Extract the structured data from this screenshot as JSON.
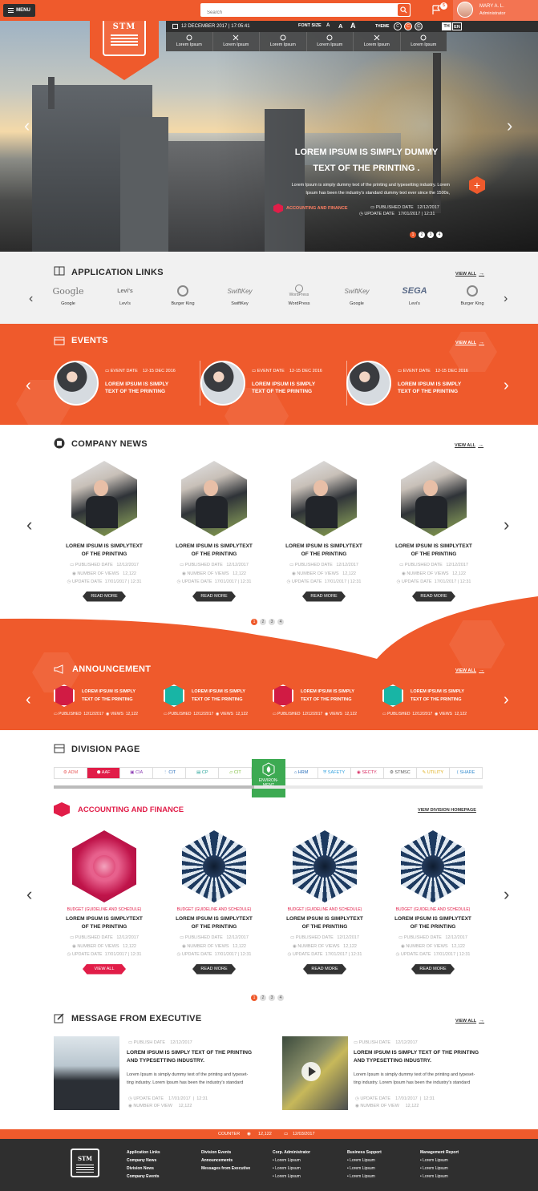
{
  "topbar": {
    "menu_label": "MENU",
    "search_placeholder": "Search",
    "notif_count": "5",
    "user_name": "MARY A. L.",
    "user_role": "Administrator"
  },
  "subbar": {
    "date": "12 DECEMBER 2017 | 17:05:41",
    "font_size_label": "FONT SIZE",
    "font_a": [
      "A",
      "A",
      "A"
    ],
    "theme_label": "THEME",
    "theme_options": [
      "C",
      "C",
      "C"
    ],
    "lang": [
      "TH",
      "EN"
    ]
  },
  "logo": "STM",
  "quicklinks": [
    "Lorem Ipsum",
    "Lorem Ipsum",
    "Lorem Ipsum",
    "Lorem Ipsum",
    "Lorem Ipsum",
    "Lorem Ipsum"
  ],
  "hero": {
    "title1": "LOREM IPSUM IS SIMPLY DUMMY",
    "title2": "TEXT OF THE PRINTING .",
    "desc1": "Lorem Ipsum is simply dummy text of the printing and typesetting industry. Lorem",
    "desc2": "Ipsum has been the industry's standard dummy text ever since the 1500s,",
    "tag": "ACCOUNTING AND FINANCE",
    "pub_label": "PUBLISHED DATE",
    "pub_date": "12/12/2017",
    "upd_label": "UPDATE DATE",
    "upd_date": "17/01/2017",
    "upd_time": "12:31",
    "dots": [
      "1",
      "2",
      "3",
      "4"
    ],
    "active_dot": 1
  },
  "app_links": {
    "title": "APPLICATION LINKS",
    "view_all": "VIEW ALL",
    "items": [
      {
        "logo": "Google",
        "name": "Google"
      },
      {
        "logo": "Levi's",
        "name": "Levi's"
      },
      {
        "logo": "",
        "name": "Burger King"
      },
      {
        "logo": "SwiftKey",
        "name": "SwiftKey"
      },
      {
        "logo": "WordPress",
        "name": "WordPress"
      },
      {
        "logo": "SwiftKey",
        "name": "Google"
      },
      {
        "logo": "SEGA",
        "name": "Levi's"
      },
      {
        "logo": "",
        "name": "Burger King"
      }
    ]
  },
  "events": {
    "title": "EVENTS",
    "view_all": "VIEW ALL",
    "items": [
      {
        "date_label": "EVENT DATE",
        "date": "12-15 DEC 2016",
        "title1": "LOREM IPSUM IS SIMPLY",
        "title2": "TEXT OF THE PRINTING"
      },
      {
        "date_label": "EVENT DATE",
        "date": "12-15 DEC 2016",
        "title1": "LOREM IPSUM IS SIMPLY",
        "title2": "TEXT OF THE PRINTING"
      },
      {
        "date_label": "EVENT DATE",
        "date": "12-15 DEC 2016",
        "title1": "LOREM IPSUM IS SIMPLY",
        "title2": "TEXT OF THE PRINTING"
      }
    ]
  },
  "news": {
    "title": "COMPANY NEWS",
    "view_all": "VIEW ALL",
    "items": [
      {
        "title1": "LOREM IPSUM IS SIMPLYTEXT",
        "title2": "OF THE PRINTING",
        "pub": "PUBLISHED DATE",
        "pub_d": "12/12/2017",
        "views": "NUMBER OF VIEWS",
        "views_n": "12,122",
        "upd": "UPDATE DATE",
        "upd_d": "17/01/2017",
        "upd_t": "12:31",
        "btn": "READ MORE"
      },
      {
        "title1": "LOREM IPSUM IS SIMPLYTEXT",
        "title2": "OF THE PRINTING",
        "pub": "PUBLISHED DATE",
        "pub_d": "12/12/2017",
        "views": "NUMBER OF VIEWS",
        "views_n": "12,122",
        "upd": "UPDATE DATE",
        "upd_d": "17/01/2017",
        "upd_t": "12:31",
        "btn": "READ MORE"
      },
      {
        "title1": "LOREM IPSUM IS SIMPLYTEXT",
        "title2": "OF THE PRINTING",
        "pub": "PUBLISHED DATE",
        "pub_d": "12/12/2017",
        "views": "NUMBER OF VIEWS",
        "views_n": "12,122",
        "upd": "UPDATE DATE",
        "upd_d": "17/01/2017",
        "upd_t": "12:31",
        "btn": "READ MORE"
      },
      {
        "title1": "LOREM IPSUM IS SIMPLYTEXT",
        "title2": "OF THE PRINTING",
        "pub": "PUBLISHED DATE",
        "pub_d": "12/12/2017",
        "views": "NUMBER OF VIEWS",
        "views_n": "12,122",
        "upd": "UPDATE DATE",
        "upd_d": "17/01/2017",
        "upd_t": "12:31",
        "btn": "READ MORE"
      }
    ],
    "dots": [
      "1",
      "2",
      "3",
      "4"
    ]
  },
  "announcement": {
    "title": "ANNOUNCEMENT",
    "view_all": "VIEW ALL",
    "items": [
      {
        "title1": "LOREM IPSUM IS SIMPLY",
        "title2": "TEXT OF THE PRINTING",
        "pub": "PUBLISHED",
        "pub_d": "12/12/2017",
        "views": "VIEWS",
        "views_n": "12,122",
        "color": "#d11b44"
      },
      {
        "title1": "LOREM IPSUM IS SIMPLY",
        "title2": "TEXT OF THE PRINTING",
        "pub": "PUBLISHED",
        "pub_d": "12/12/2017",
        "views": "VIEWS",
        "views_n": "12,122",
        "color": "#18b5a5"
      },
      {
        "title1": "LOREM IPSUM IS SIMPLY",
        "title2": "TEXT OF THE PRINTING",
        "pub": "PUBLISHED",
        "pub_d": "12/12/2017",
        "views": "VIEWS",
        "views_n": "12,122",
        "color": "#d11b44"
      },
      {
        "title1": "LOREM IPSUM IS SIMPLY",
        "title2": "TEXT OF THE PRINTING",
        "pub": "PUBLISHED",
        "pub_d": "12/12/2017",
        "views": "VIEWS",
        "views_n": "12,122",
        "color": "#18b5a5"
      }
    ]
  },
  "division": {
    "title": "DIVISION PAGE",
    "tabs": [
      {
        "label": "ADM",
        "color": "#e85d5d"
      },
      {
        "label": "AAF",
        "color": "#ffffff"
      },
      {
        "label": "CIA",
        "color": "#8e3fb5"
      },
      {
        "label": "CIT",
        "color": "#2a6fbb"
      },
      {
        "label": "CP",
        "color": "#2aa59a"
      },
      {
        "label": "CIT",
        "color": "#7fbf3f"
      },
      {
        "label": "",
        "color": "#3daa52"
      },
      {
        "label": "HRM",
        "color": "#2a6fbb"
      },
      {
        "label": "SAFETY",
        "color": "#3aa5e0"
      },
      {
        "label": "SECTY.",
        "color": "#d92d63"
      },
      {
        "label": "STMSC",
        "color": "#555555"
      },
      {
        "label": "UTILITY",
        "color": "#e0b020"
      },
      {
        "label": "SHARE",
        "color": "#3a8fd0"
      }
    ],
    "env_label1": "ENVIRON-",
    "env_label2": "MENT",
    "sub_title": "ACCOUNTING AND FINANCE",
    "view_home": "VIEW DIVISION HOMEPAGE",
    "items": [
      {
        "budget": "BUDGET (GUIDELINE AND SCHEDULE)",
        "title1": "LOREM IPSUM IS SIMPLYTEXT",
        "title2": "OF THE PRINTING",
        "pub": "PUBLISHED DATE",
        "pub_d": "12/12/2017",
        "views": "NUMBER OF VIEWS",
        "views_n": "12,122",
        "upd": "UPDATE DATE",
        "upd_d": "17/01/2017",
        "upd_t": "12:31",
        "btn": "VIEW ALL"
      },
      {
        "budget": "BUDGET (GUIDELINE AND SCHEDULE)",
        "title1": "LOREM IPSUM IS SIMPLYTEXT",
        "title2": "OF THE PRINTING",
        "pub": "PUBLISHED DATE",
        "pub_d": "12/12/2017",
        "views": "NUMBER OF VIEWS",
        "views_n": "12,122",
        "upd": "UPDATE DATE",
        "upd_d": "17/01/2017",
        "upd_t": "12:31",
        "btn": "READ MORE"
      },
      {
        "budget": "BUDGET (GUIDELINE AND SCHEDULE)",
        "title1": "LOREM IPSUM IS SIMPLYTEXT",
        "title2": "OF THE PRINTING",
        "pub": "PUBLISHED DATE",
        "pub_d": "12/12/2017",
        "views": "NUMBER OF VIEWS",
        "views_n": "12,122",
        "upd": "UPDATE DATE",
        "upd_d": "17/01/2017",
        "upd_t": "12:31",
        "btn": "READ MORE"
      },
      {
        "budget": "BUDGET (GUIDELINE AND SCHEDULE)",
        "title1": "LOREM IPSUM IS SIMPLYTEXT",
        "title2": "OF THE PRINTING",
        "pub": "PUBLISHED DATE",
        "pub_d": "12/12/2017",
        "views": "NUMBER OF VIEWS",
        "views_n": "12,122",
        "upd": "UPDATE DATE",
        "upd_d": "17/01/2017",
        "upd_t": "12:31",
        "btn": "READ MORE"
      }
    ],
    "dots": [
      "1",
      "2",
      "3",
      "4"
    ]
  },
  "message": {
    "title": "MESSAGE FROM EXECUTIVE",
    "view_all": "VIEW ALL",
    "items": [
      {
        "pub": "PUBLISH DATE",
        "pub_d": "12/12/2017",
        "title1": "LOREM IPSUM IS SIMPLY TEXT OF THE PRINTING",
        "title2": "AND TYPESETTING INDUSTRY.",
        "desc1": "Lorem Ipsum is simply dummy text of the printing and typeset-",
        "desc2": "ting industry. Lorem Ipsum has been the industry's standard",
        "upd": "UPDATE DATE",
        "upd_d": "17/01/2017",
        "upd_t": "12:31",
        "views": "NUMBER OF VIEW",
        "views_n": "12,122"
      },
      {
        "pub": "PUBLISH DATE",
        "pub_d": "12/12/2017",
        "title1": "LOREM IPSUM IS SIMPLY TEXT OF THE PRINTING",
        "title2": "AND TYPESETTING INDUSTRY.",
        "desc1": "Lorem Ipsum is simply dummy text of the printing and typeset-",
        "desc2": "ting industry. Lorem Ipsum has been the industry's standard",
        "upd": "UPDATE DATE",
        "upd_d": "17/01/2017",
        "upd_t": "12:31",
        "views": "NUMBER OF VIEW",
        "views_n": "12,122"
      }
    ]
  },
  "counter": {
    "label": "COUNTER",
    "count": "12,122",
    "date": "12/03/2017"
  },
  "footer": {
    "logo": "STM",
    "cols": [
      {
        "items": [
          "Application Links",
          "Company News",
          "Division News",
          "Company Events"
        ]
      },
      {
        "items": [
          "Division Events",
          "Announcements",
          "Messages from Executive"
        ]
      },
      {
        "items": [
          "Corp. Administrator",
          "• Lorem Lipsum",
          "• Lorem Lipsum",
          "• Lorem Lipsum"
        ]
      },
      {
        "items": [
          "Business Support",
          "• Lorem Lipsum",
          "• Lorem Lipsum",
          "• Lorem Lipsum"
        ]
      },
      {
        "items": [
          "Management Report",
          "• Lorem Lipsum",
          "• Lorem Lipsum",
          "• Lorem Lipsum"
        ]
      }
    ]
  },
  "colors": {
    "accent": "#ef5a2c",
    "dark": "#2e2e2e",
    "pink": "#e11d48"
  }
}
